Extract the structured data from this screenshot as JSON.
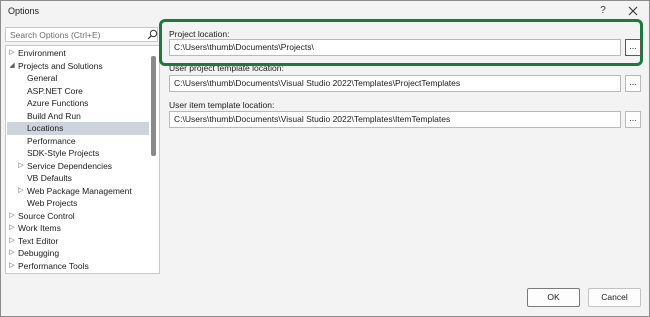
{
  "window": {
    "title": "Options",
    "help_label": "?"
  },
  "search": {
    "placeholder": "Search Options (Ctrl+E)"
  },
  "tree": {
    "items": [
      {
        "label": "Environment",
        "arrow": "▷"
      },
      {
        "label": "Projects and Solutions",
        "arrow": "◢"
      },
      {
        "label": "General",
        "arrow": ""
      },
      {
        "label": "ASP.NET Core",
        "arrow": ""
      },
      {
        "label": "Azure Functions",
        "arrow": ""
      },
      {
        "label": "Build And Run",
        "arrow": ""
      },
      {
        "label": "Locations",
        "arrow": "",
        "selected": true
      },
      {
        "label": "Performance",
        "arrow": ""
      },
      {
        "label": "SDK-Style Projects",
        "arrow": ""
      },
      {
        "label": "Service Dependencies",
        "arrow": "▷"
      },
      {
        "label": "VB Defaults",
        "arrow": ""
      },
      {
        "label": "Web Package Management",
        "arrow": "▷"
      },
      {
        "label": "Web Projects",
        "arrow": ""
      },
      {
        "label": "Source Control",
        "arrow": "▷"
      },
      {
        "label": "Work Items",
        "arrow": "▷"
      },
      {
        "label": "Text Editor",
        "arrow": "▷"
      },
      {
        "label": "Debugging",
        "arrow": "▷"
      },
      {
        "label": "Performance Tools",
        "arrow": "▷"
      }
    ]
  },
  "fields": {
    "project_location": {
      "label": "Project location:",
      "value": "C:\\Users\\thumb\\Documents\\Projects\\"
    },
    "user_project_template": {
      "label": "User project template location:",
      "value": "C:\\Users\\thumb\\Documents\\Visual Studio 2022\\Templates\\ProjectTemplates"
    },
    "user_item_template": {
      "label": "User item template location:",
      "value": "C:\\Users\\thumb\\Documents\\Visual Studio 2022\\Templates\\ItemTemplates"
    },
    "browse_label": "..."
  },
  "buttons": {
    "ok": "OK",
    "cancel": "Cancel"
  },
  "colors": {
    "highlight": "#1d7a3c",
    "selected_row": "#cfd3de"
  }
}
